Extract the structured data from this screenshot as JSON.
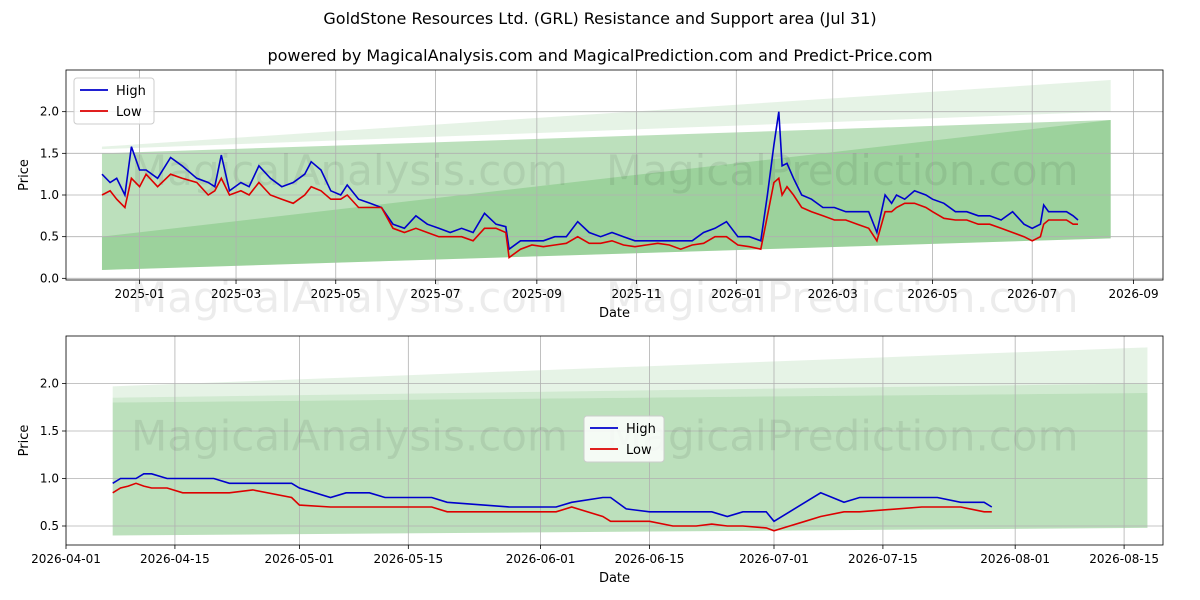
{
  "title": "GoldStone Resources Ltd. (GRL) Resistance and Support area (Jul 31)",
  "subtitle": "powered by MagicalAnalysis.com and MagicalPrediction.com and Predict-Price.com",
  "watermarks": [
    "MagicalAnalysis.com",
    "MagicalPrediction.com"
  ],
  "colors": {
    "high": "#0000cc",
    "low": "#dd0000",
    "band": "#2e9e2e",
    "grid": "#b0b0b0"
  },
  "chart_data": [
    {
      "type": "line",
      "xlabel": "Date",
      "ylabel": "Price",
      "xlim": [
        "2024-11-17",
        "2026-09-19"
      ],
      "ylim": [
        -0.02,
        2.5
      ],
      "grid": true,
      "legend": "top-left",
      "x_ticks": [
        "2025-01",
        "2025-03",
        "2025-05",
        "2025-07",
        "2025-09",
        "2025-11",
        "2026-01",
        "2026-03",
        "2026-05",
        "2026-07",
        "2026-09"
      ],
      "y_ticks": [
        "0.0",
        "0.5",
        "1.0",
        "1.5",
        "2.0"
      ],
      "series": [
        {
          "name": "High",
          "x": [
            "2024-12-09",
            "2024-12-14",
            "2024-12-18",
            "2024-12-23",
            "2024-12-27",
            "2025-01-01",
            "2025-01-05",
            "2025-01-12",
            "2025-01-20",
            "2025-01-27",
            "2025-02-05",
            "2025-02-12",
            "2025-02-16",
            "2025-02-20",
            "2025-02-25",
            "2025-03-04",
            "2025-03-09",
            "2025-03-15",
            "2025-03-22",
            "2025-03-29",
            "2025-04-05",
            "2025-04-12",
            "2025-04-16",
            "2025-04-22",
            "2025-04-28",
            "2025-05-04",
            "2025-05-08",
            "2025-05-15",
            "2025-05-22",
            "2025-05-29",
            "2025-06-05",
            "2025-06-12",
            "2025-06-19",
            "2025-06-26",
            "2025-07-03",
            "2025-07-10",
            "2025-07-17",
            "2025-07-24",
            "2025-07-31",
            "2025-08-07",
            "2025-08-13",
            "2025-08-15",
            "2025-08-22",
            "2025-08-29",
            "2025-09-05",
            "2025-09-12",
            "2025-09-19",
            "2025-09-26",
            "2025-10-03",
            "2025-10-10",
            "2025-10-17",
            "2025-10-24",
            "2025-10-31",
            "2025-11-07",
            "2025-11-14",
            "2025-11-21",
            "2025-11-28",
            "2025-12-05",
            "2025-12-12",
            "2025-12-19",
            "2025-12-26",
            "2026-01-02",
            "2026-01-09",
            "2026-01-16",
            "2026-01-20",
            "2026-01-24",
            "2026-01-27",
            "2026-01-29",
            "2026-02-01",
            "2026-02-05",
            "2026-02-10",
            "2026-02-16",
            "2026-02-23",
            "2026-03-02",
            "2026-03-09",
            "2026-03-16",
            "2026-03-23",
            "2026-03-28",
            "2026-04-02",
            "2026-04-06",
            "2026-04-09",
            "2026-04-14",
            "2026-04-20",
            "2026-04-27",
            "2026-05-01",
            "2026-05-08",
            "2026-05-15",
            "2026-05-22",
            "2026-05-29",
            "2026-06-05",
            "2026-06-12",
            "2026-06-19",
            "2026-06-26",
            "2026-07-01",
            "2026-07-06",
            "2026-07-08",
            "2026-07-11",
            "2026-07-16",
            "2026-07-22",
            "2026-07-26",
            "2026-07-29"
          ],
          "y": [
            1.25,
            1.15,
            1.2,
            1.0,
            1.58,
            1.3,
            1.3,
            1.2,
            1.45,
            1.35,
            1.2,
            1.15,
            1.1,
            1.48,
            1.05,
            1.15,
            1.1,
            1.35,
            1.2,
            1.1,
            1.15,
            1.25,
            1.4,
            1.3,
            1.05,
            1.0,
            1.12,
            0.95,
            0.9,
            0.85,
            0.65,
            0.6,
            0.75,
            0.65,
            0.6,
            0.55,
            0.6,
            0.55,
            0.78,
            0.65,
            0.62,
            0.35,
            0.45,
            0.45,
            0.45,
            0.5,
            0.5,
            0.68,
            0.55,
            0.5,
            0.55,
            0.5,
            0.45,
            0.45,
            0.45,
            0.45,
            0.45,
            0.45,
            0.55,
            0.6,
            0.68,
            0.5,
            0.5,
            0.45,
            1.0,
            1.6,
            2.0,
            1.35,
            1.38,
            1.2,
            1.0,
            0.95,
            0.85,
            0.85,
            0.8,
            0.8,
            0.8,
            0.55,
            1.0,
            0.9,
            1.0,
            0.95,
            1.05,
            1.0,
            0.95,
            0.9,
            0.8,
            0.8,
            0.75,
            0.75,
            0.7,
            0.8,
            0.65,
            0.6,
            0.65,
            0.88,
            0.8,
            0.8,
            0.8,
            0.75,
            0.7
          ]
        },
        {
          "name": "Low",
          "x": [
            "2024-12-09",
            "2024-12-14",
            "2024-12-18",
            "2024-12-23",
            "2024-12-27",
            "2025-01-01",
            "2025-01-05",
            "2025-01-12",
            "2025-01-20",
            "2025-01-27",
            "2025-02-05",
            "2025-02-12",
            "2025-02-16",
            "2025-02-20",
            "2025-02-25",
            "2025-03-04",
            "2025-03-09",
            "2025-03-15",
            "2025-03-22",
            "2025-03-29",
            "2025-04-05",
            "2025-04-12",
            "2025-04-16",
            "2025-04-22",
            "2025-04-28",
            "2025-05-04",
            "2025-05-08",
            "2025-05-15",
            "2025-05-22",
            "2025-05-29",
            "2025-06-05",
            "2025-06-12",
            "2025-06-19",
            "2025-06-26",
            "2025-07-03",
            "2025-07-10",
            "2025-07-17",
            "2025-07-24",
            "2025-07-31",
            "2025-08-07",
            "2025-08-13",
            "2025-08-15",
            "2025-08-22",
            "2025-08-29",
            "2025-09-05",
            "2025-09-12",
            "2025-09-19",
            "2025-09-26",
            "2025-10-03",
            "2025-10-10",
            "2025-10-17",
            "2025-10-24",
            "2025-10-31",
            "2025-11-07",
            "2025-11-14",
            "2025-11-21",
            "2025-11-28",
            "2025-12-05",
            "2025-12-12",
            "2025-12-19",
            "2025-12-26",
            "2026-01-02",
            "2026-01-09",
            "2026-01-16",
            "2026-01-20",
            "2026-01-24",
            "2026-01-27",
            "2026-01-29",
            "2026-02-01",
            "2026-02-05",
            "2026-02-10",
            "2026-02-16",
            "2026-02-23",
            "2026-03-02",
            "2026-03-09",
            "2026-03-16",
            "2026-03-23",
            "2026-03-28",
            "2026-04-02",
            "2026-04-06",
            "2026-04-09",
            "2026-04-14",
            "2026-04-20",
            "2026-04-27",
            "2026-05-01",
            "2026-05-08",
            "2026-05-15",
            "2026-05-22",
            "2026-05-29",
            "2026-06-05",
            "2026-06-12",
            "2026-06-19",
            "2026-06-26",
            "2026-07-01",
            "2026-07-06",
            "2026-07-08",
            "2026-07-11",
            "2026-07-16",
            "2026-07-22",
            "2026-07-26",
            "2026-07-29"
          ],
          "y": [
            1.0,
            1.05,
            0.95,
            0.85,
            1.2,
            1.1,
            1.25,
            1.1,
            1.25,
            1.2,
            1.15,
            1.0,
            1.05,
            1.2,
            1.0,
            1.05,
            1.0,
            1.15,
            1.0,
            0.95,
            0.9,
            1.0,
            1.1,
            1.05,
            0.95,
            0.95,
            1.0,
            0.85,
            0.85,
            0.85,
            0.6,
            0.55,
            0.6,
            0.55,
            0.5,
            0.5,
            0.5,
            0.45,
            0.6,
            0.6,
            0.55,
            0.25,
            0.35,
            0.4,
            0.38,
            0.4,
            0.42,
            0.5,
            0.42,
            0.42,
            0.45,
            0.4,
            0.38,
            0.4,
            0.42,
            0.4,
            0.35,
            0.4,
            0.42,
            0.5,
            0.5,
            0.4,
            0.38,
            0.35,
            0.75,
            1.15,
            1.2,
            1.0,
            1.1,
            1.0,
            0.85,
            0.8,
            0.75,
            0.7,
            0.7,
            0.65,
            0.6,
            0.45,
            0.8,
            0.8,
            0.85,
            0.9,
            0.9,
            0.85,
            0.8,
            0.72,
            0.7,
            0.7,
            0.65,
            0.65,
            0.6,
            0.55,
            0.5,
            0.45,
            0.5,
            0.65,
            0.7,
            0.7,
            0.7,
            0.65,
            0.65
          ]
        }
      ],
      "bands": [
        {
          "x": [
            "2024-12-09",
            "2026-08-18"
          ],
          "upper": [
            1.5,
            1.9
          ],
          "lower": [
            0.1,
            0.48
          ]
        },
        {
          "x": [
            "2024-12-09",
            "2026-08-18"
          ],
          "upper": [
            0.5,
            1.9
          ],
          "lower": [
            0.1,
            0.48
          ]
        },
        {
          "x": [
            "2024-12-09",
            "2026-08-18"
          ],
          "upper": [
            1.58,
            2.38
          ],
          "lower": [
            1.55,
            2.0
          ]
        }
      ]
    },
    {
      "type": "line",
      "xlabel": "Date",
      "ylabel": "Price",
      "xlim": [
        "2026-04-01",
        "2026-08-20"
      ],
      "ylim": [
        0.3,
        2.5
      ],
      "grid": true,
      "legend": "center",
      "x_ticks": [
        "2026-04-01",
        "2026-04-15",
        "2026-05-01",
        "2026-05-15",
        "2026-06-01",
        "2026-06-15",
        "2026-07-01",
        "2026-07-15",
        "2026-08-01",
        "2026-08-15"
      ],
      "y_ticks": [
        "0.5",
        "1.0",
        "1.5",
        "2.0"
      ],
      "series": [
        {
          "name": "High",
          "x": [
            "2026-04-07",
            "2026-04-08",
            "2026-04-09",
            "2026-04-10",
            "2026-04-11",
            "2026-04-12",
            "2026-04-14",
            "2026-04-16",
            "2026-04-20",
            "2026-04-22",
            "2026-04-25",
            "2026-04-30",
            "2026-05-01",
            "2026-05-05",
            "2026-05-07",
            "2026-05-10",
            "2026-05-12",
            "2026-05-18",
            "2026-05-20",
            "2026-05-28",
            "2026-06-03",
            "2026-06-05",
            "2026-06-09",
            "2026-06-10",
            "2026-06-12",
            "2026-06-15",
            "2026-06-18",
            "2026-06-21",
            "2026-06-23",
            "2026-06-25",
            "2026-06-27",
            "2026-06-30",
            "2026-07-01",
            "2026-07-03",
            "2026-07-05",
            "2026-07-07",
            "2026-07-10",
            "2026-07-12",
            "2026-07-20",
            "2026-07-22",
            "2026-07-25",
            "2026-07-28",
            "2026-07-29"
          ],
          "y": [
            0.95,
            1.0,
            1.0,
            1.0,
            1.05,
            1.05,
            1.0,
            1.0,
            1.0,
            0.95,
            0.95,
            0.95,
            0.9,
            0.8,
            0.85,
            0.85,
            0.8,
            0.8,
            0.75,
            0.7,
            0.7,
            0.75,
            0.8,
            0.8,
            0.68,
            0.65,
            0.65,
            0.65,
            0.65,
            0.6,
            0.65,
            0.65,
            0.55,
            0.65,
            0.75,
            0.85,
            0.75,
            0.8,
            0.8,
            0.8,
            0.75,
            0.75,
            0.7
          ]
        },
        {
          "name": "Low",
          "x": [
            "2026-04-07",
            "2026-04-08",
            "2026-04-09",
            "2026-04-10",
            "2026-04-11",
            "2026-04-12",
            "2026-04-14",
            "2026-04-16",
            "2026-04-20",
            "2026-04-22",
            "2026-04-25",
            "2026-04-30",
            "2026-05-01",
            "2026-05-05",
            "2026-05-07",
            "2026-05-10",
            "2026-05-12",
            "2026-05-18",
            "2026-05-20",
            "2026-05-28",
            "2026-06-03",
            "2026-06-05",
            "2026-06-09",
            "2026-06-10",
            "2026-06-12",
            "2026-06-15",
            "2026-06-18",
            "2026-06-21",
            "2026-06-23",
            "2026-06-25",
            "2026-06-27",
            "2026-06-30",
            "2026-07-01",
            "2026-07-03",
            "2026-07-05",
            "2026-07-07",
            "2026-07-10",
            "2026-07-12",
            "2026-07-20",
            "2026-07-22",
            "2026-07-25",
            "2026-07-28",
            "2026-07-29"
          ],
          "y": [
            0.85,
            0.9,
            0.92,
            0.95,
            0.92,
            0.9,
            0.9,
            0.85,
            0.85,
            0.85,
            0.88,
            0.8,
            0.72,
            0.7,
            0.7,
            0.7,
            0.7,
            0.7,
            0.65,
            0.65,
            0.65,
            0.7,
            0.6,
            0.55,
            0.55,
            0.55,
            0.5,
            0.5,
            0.52,
            0.5,
            0.5,
            0.48,
            0.45,
            0.5,
            0.55,
            0.6,
            0.65,
            0.65,
            0.7,
            0.7,
            0.7,
            0.65,
            0.65
          ]
        }
      ],
      "bands": [
        {
          "x": [
            "2026-04-07",
            "2026-08-18"
          ],
          "upper": [
            1.8,
            1.9
          ],
          "lower": [
            0.4,
            0.48
          ]
        },
        {
          "x": [
            "2026-04-07",
            "2026-08-18"
          ],
          "upper": [
            1.85,
            2.0
          ],
          "lower": [
            1.8,
            1.9
          ]
        },
        {
          "x": [
            "2026-04-07",
            "2026-08-18"
          ],
          "upper": [
            1.97,
            2.38
          ],
          "lower": [
            1.85,
            2.0
          ]
        }
      ]
    }
  ]
}
